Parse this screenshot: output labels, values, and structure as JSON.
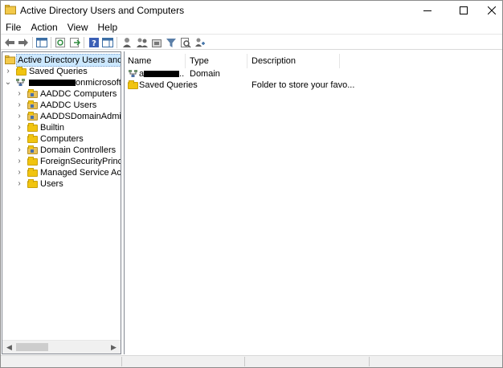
{
  "window": {
    "title": "Active Directory Users and Computers",
    "controls": {
      "minimize": "—",
      "maximize": "☐",
      "close": "✕"
    }
  },
  "menu": {
    "items": [
      {
        "label": "File"
      },
      {
        "label": "Action"
      },
      {
        "label": "View"
      },
      {
        "label": "Help"
      }
    ]
  },
  "toolbar": {
    "buttons": [
      {
        "icon": "back-arrow-icon"
      },
      {
        "icon": "forward-arrow-icon"
      },
      {
        "icon": "show-console-tree-icon"
      },
      {
        "icon": "refresh-icon"
      },
      {
        "icon": "export-list-icon"
      },
      {
        "icon": "help-icon"
      },
      {
        "icon": "show-action-pane-icon"
      },
      {
        "icon": "new-user-icon"
      },
      {
        "icon": "new-group-icon"
      },
      {
        "icon": "new-ou-icon"
      },
      {
        "icon": "filter-icon"
      },
      {
        "icon": "find-icon"
      },
      {
        "icon": "add-to-group-icon"
      }
    ]
  },
  "tree": {
    "root": {
      "label": "Active Directory Users and Com",
      "icon": "console-root-icon"
    },
    "items": [
      {
        "label": "Saved Queries",
        "icon": "folder-icon",
        "expander": "›"
      },
      {
        "label_suffix": "onmicrosoft",
        "icon": "domain-icon",
        "expander": "⌄",
        "redacted": true
      },
      {
        "label": "AADDC Computers",
        "icon": "ou-folder-icon",
        "expander": "›"
      },
      {
        "label": "AADDC Users",
        "icon": "ou-folder-icon",
        "expander": "›"
      },
      {
        "label": "AADDSDomainAdmin",
        "icon": "ou-folder-icon",
        "expander": "›"
      },
      {
        "label": "Builtin",
        "icon": "folder-icon",
        "expander": "›"
      },
      {
        "label": "Computers",
        "icon": "folder-icon",
        "expander": "›"
      },
      {
        "label": "Domain Controllers",
        "icon": "ou-folder-icon",
        "expander": "›"
      },
      {
        "label": "ForeignSecurityPrincipals",
        "icon": "folder-icon",
        "expander": "›"
      },
      {
        "label": "Managed Service Accour",
        "icon": "folder-icon",
        "expander": "›"
      },
      {
        "label": "Users",
        "icon": "folder-icon",
        "expander": "›"
      }
    ]
  },
  "list": {
    "columns": [
      {
        "label": "Name"
      },
      {
        "label": "Type"
      },
      {
        "label": "Description"
      }
    ],
    "rows": [
      {
        "name_prefix": "a",
        "name_suffix": "..",
        "type": "Domain",
        "description": "",
        "icon": "domain-icon",
        "redacted": true
      },
      {
        "name": "Saved Queries",
        "type": "",
        "description": "Folder to store your favo...",
        "icon": "folder-icon"
      }
    ]
  },
  "scrollbar": {
    "left_arrow": "◀",
    "right_arrow": "▶"
  },
  "colors": {
    "selection": "#cce8ff",
    "folder": "#f1c40f",
    "border": "#828790"
  }
}
